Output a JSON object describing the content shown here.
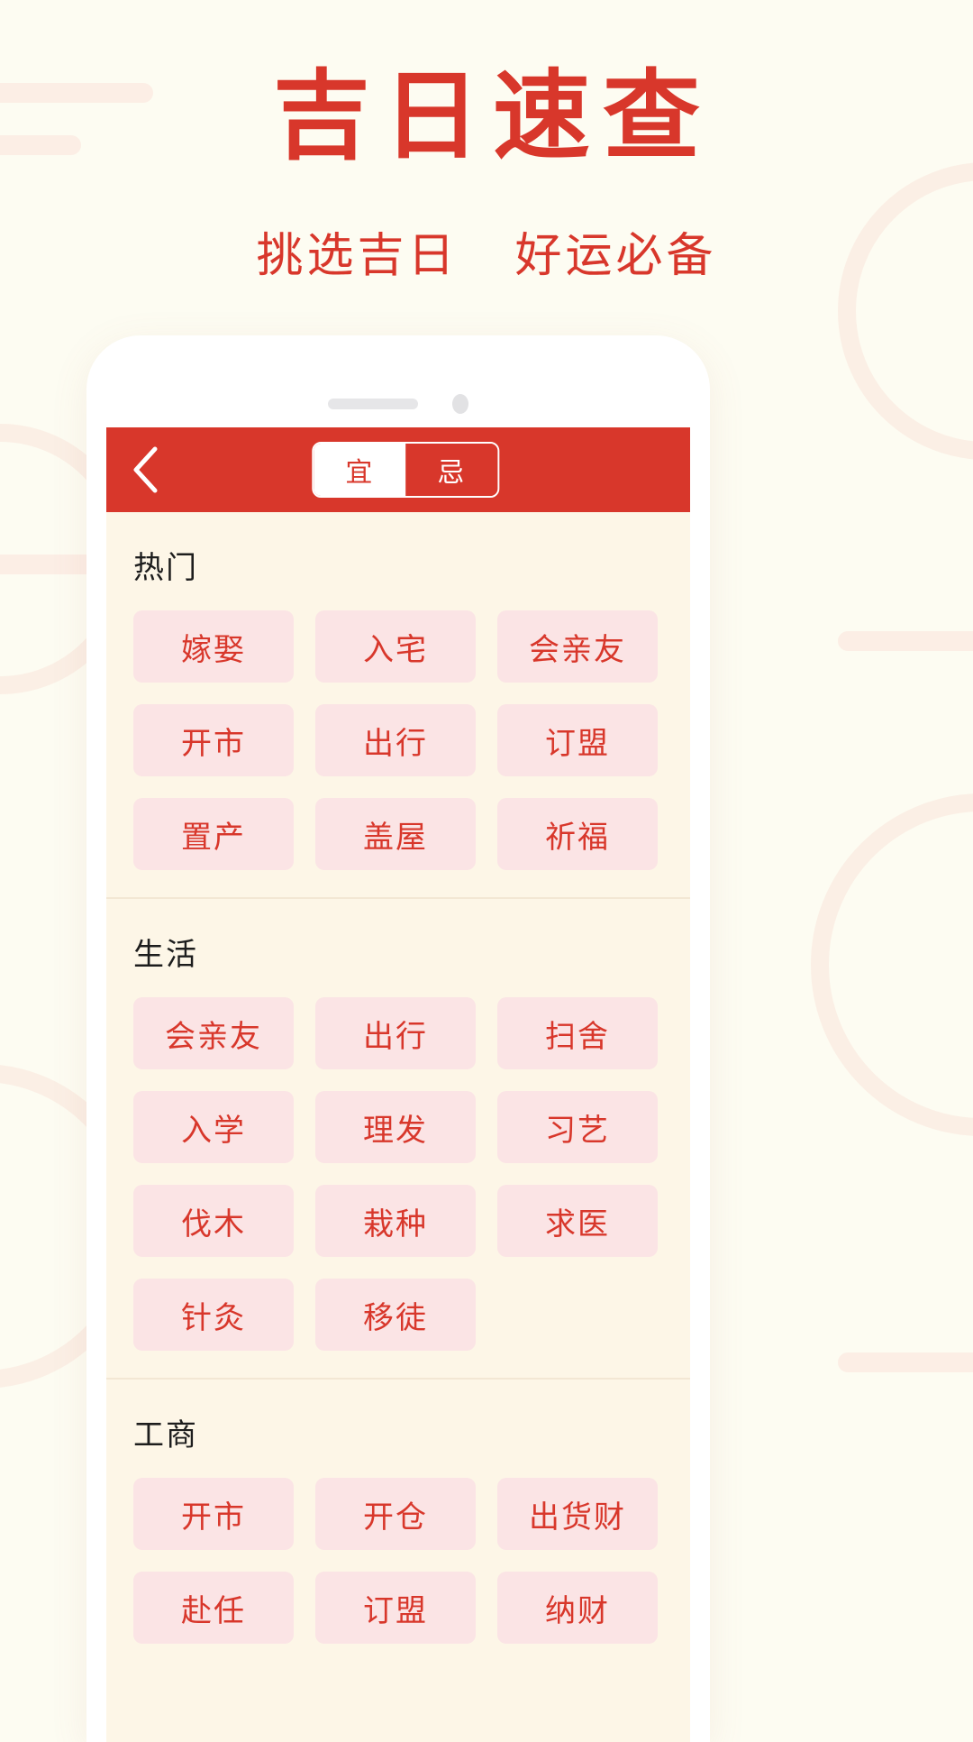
{
  "poster": {
    "title": "吉日速查",
    "subtitle_left": "挑选吉日",
    "subtitle_right": "好运必备"
  },
  "colors": {
    "brand_red": "#D8372B",
    "page_bg": "#FDFCF2",
    "screen_bg": "#FDF6E7",
    "chip_bg": "#FBE4E5",
    "deco_pink": "#FBE9E0"
  },
  "app": {
    "back_icon": "chevron-left-icon",
    "tabs": [
      {
        "label": "宜",
        "active": true
      },
      {
        "label": "忌",
        "active": false
      }
    ],
    "sections": [
      {
        "title": "热门",
        "items": [
          "嫁娶",
          "入宅",
          "会亲友",
          "开市",
          "出行",
          "订盟",
          "置产",
          "盖屋",
          "祈福"
        ]
      },
      {
        "title": "生活",
        "items": [
          "会亲友",
          "出行",
          "扫舍",
          "入学",
          "理发",
          "习艺",
          "伐木",
          "栽种",
          "求医",
          "针灸",
          "移徒"
        ]
      },
      {
        "title": "工商",
        "items": [
          "开市",
          "开仓",
          "出货财",
          "赴任",
          "订盟",
          "纳财"
        ]
      }
    ]
  }
}
